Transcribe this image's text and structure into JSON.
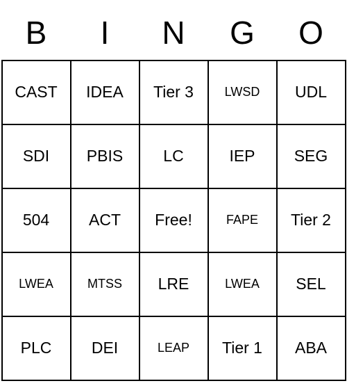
{
  "headers": [
    "B",
    "I",
    "N",
    "G",
    "O"
  ],
  "cells": [
    [
      {
        "t": "CAST",
        "cls": ""
      },
      {
        "t": "IDEA",
        "cls": ""
      },
      {
        "t": "Tier 3",
        "cls": ""
      },
      {
        "t": "LWSD",
        "cls": "sm"
      },
      {
        "t": "UDL",
        "cls": ""
      }
    ],
    [
      {
        "t": "SDI",
        "cls": ""
      },
      {
        "t": "PBIS",
        "cls": ""
      },
      {
        "t": "LC",
        "cls": ""
      },
      {
        "t": "IEP",
        "cls": ""
      },
      {
        "t": "SEG",
        "cls": ""
      }
    ],
    [
      {
        "t": "504",
        "cls": ""
      },
      {
        "t": "ACT",
        "cls": ""
      },
      {
        "t": "Free!",
        "cls": ""
      },
      {
        "t": "FAPE",
        "cls": "sm"
      },
      {
        "t": "Tier 2",
        "cls": ""
      }
    ],
    [
      {
        "t": "LWEA",
        "cls": "sm"
      },
      {
        "t": "MTSS",
        "cls": "sm"
      },
      {
        "t": "LRE",
        "cls": ""
      },
      {
        "t": "LWEA",
        "cls": "sm"
      },
      {
        "t": "SEL",
        "cls": ""
      }
    ],
    [
      {
        "t": "PLC",
        "cls": ""
      },
      {
        "t": "DEI",
        "cls": ""
      },
      {
        "t": "LEAP",
        "cls": "sm"
      },
      {
        "t": "Tier 1",
        "cls": ""
      },
      {
        "t": "ABA",
        "cls": ""
      }
    ]
  ]
}
